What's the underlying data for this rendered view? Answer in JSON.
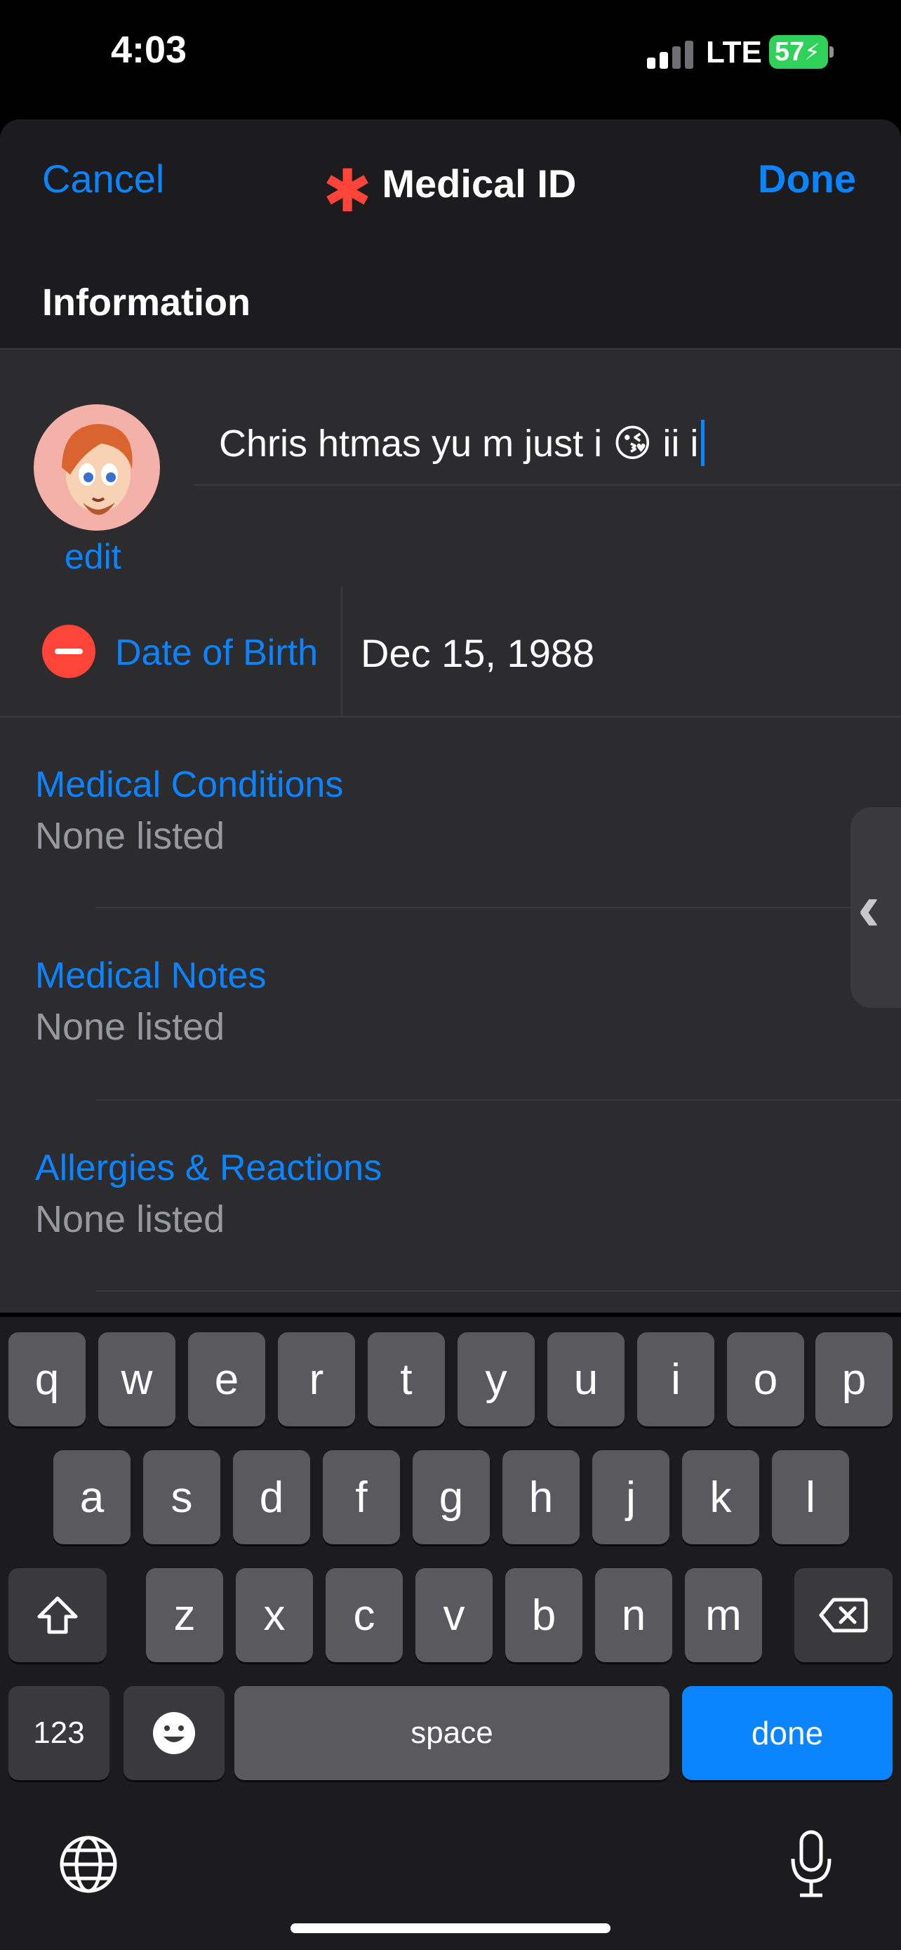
{
  "status_bar": {
    "time": "4:03",
    "network": "LTE",
    "battery": "57"
  },
  "nav": {
    "cancel": "Cancel",
    "title": "Medical ID",
    "done": "Done"
  },
  "section": {
    "title": "Information"
  },
  "profile": {
    "edit": "edit",
    "name_value": "Chris htmas  yu m just i 😘 ii i"
  },
  "dob": {
    "label": "Date of Birth",
    "value": "Dec 15, 1988"
  },
  "fields": [
    {
      "label": "Medical Conditions",
      "value": "None listed"
    },
    {
      "label": "Medical Notes",
      "value": "None listed"
    },
    {
      "label": "Allergies & Reactions",
      "value": "None listed"
    }
  ],
  "keyboard": {
    "row1": [
      "q",
      "w",
      "e",
      "r",
      "t",
      "y",
      "u",
      "i",
      "o",
      "p"
    ],
    "row2": [
      "a",
      "s",
      "d",
      "f",
      "g",
      "h",
      "j",
      "k",
      "l"
    ],
    "row3": [
      "z",
      "x",
      "c",
      "v",
      "b",
      "n",
      "m"
    ],
    "numbers": "123",
    "space": "space",
    "done": "done"
  },
  "colors": {
    "accent": "#0a84ff",
    "asterisk": "#ff453a",
    "battery": "#30d158"
  }
}
